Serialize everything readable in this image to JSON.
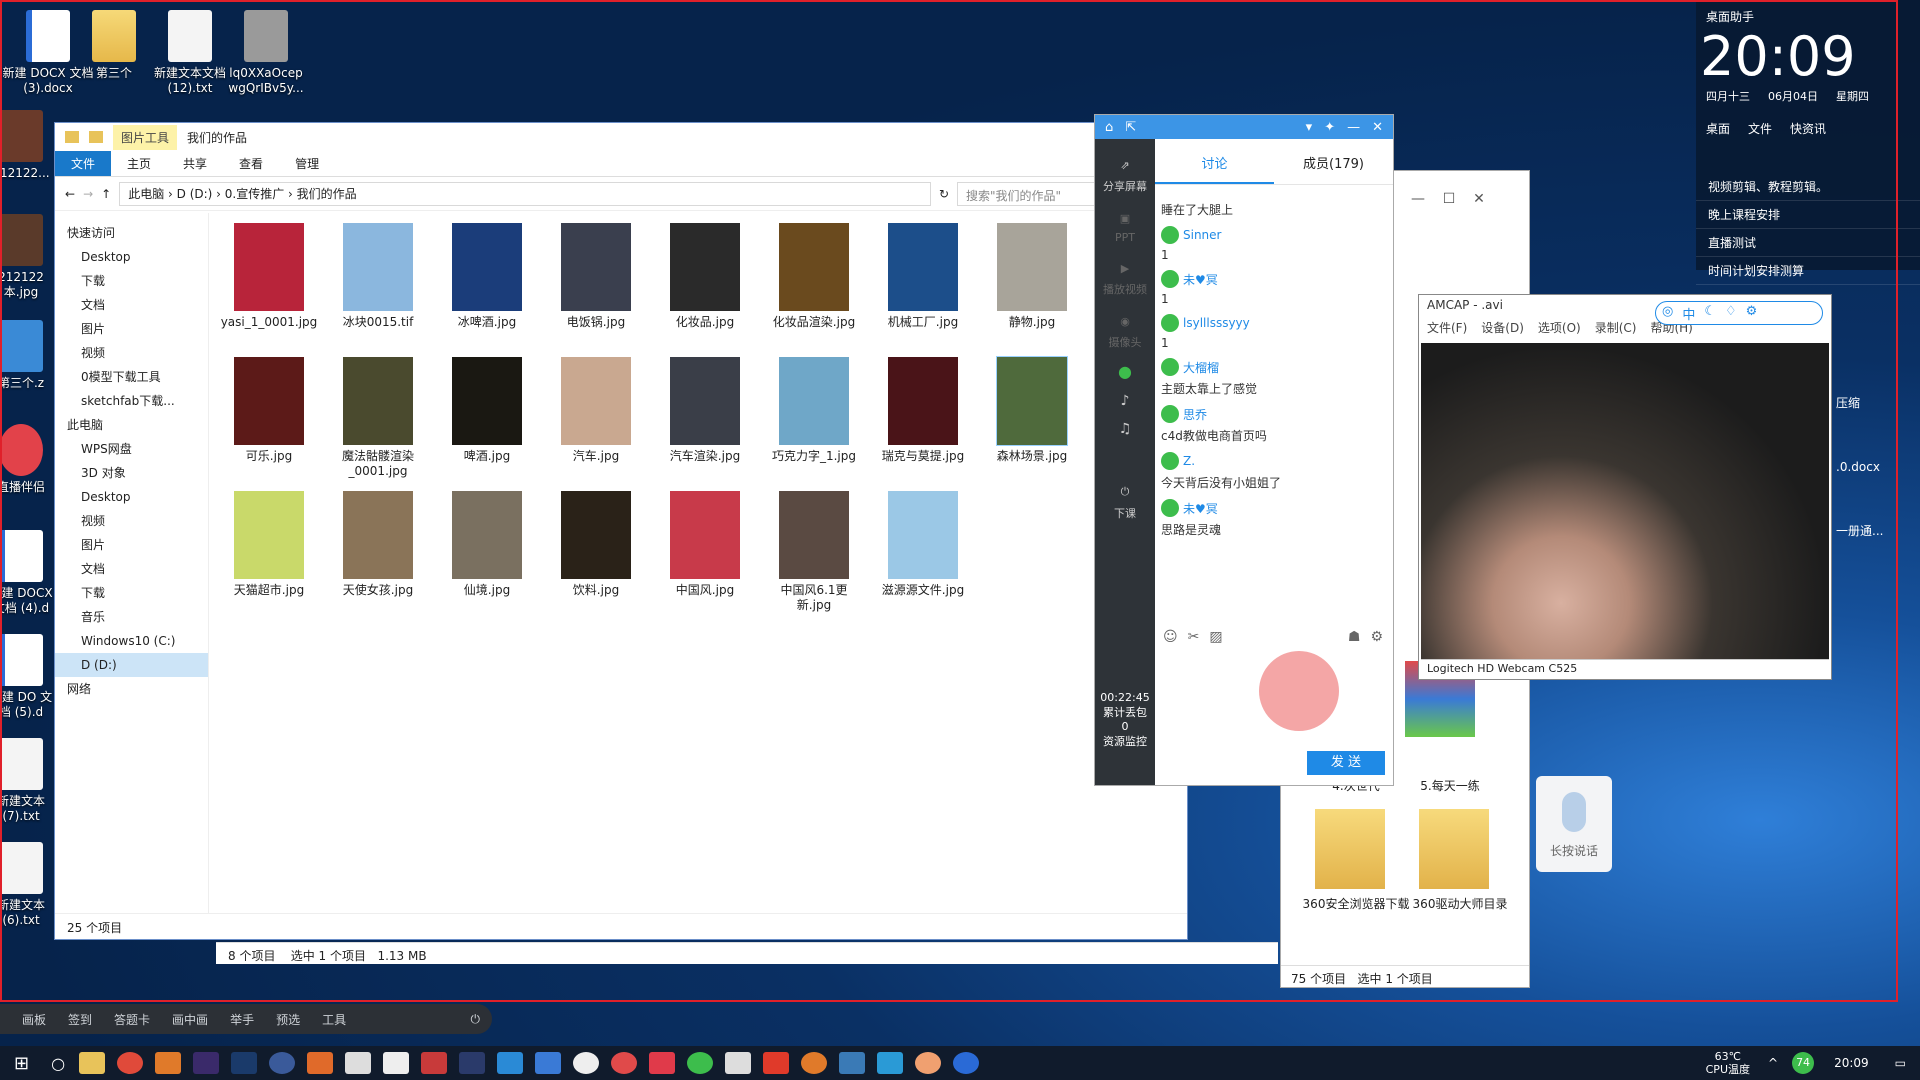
{
  "desktop": {
    "icons": [
      {
        "label": "新建 DOCX 文档 (3).docx",
        "type": "docx"
      },
      {
        "label": "第三个",
        "type": "folder"
      },
      {
        "label": "新建文本文档 (12).txt",
        "type": "txt"
      },
      {
        "label": "lq0XXaOcep wgQrIBv5y...",
        "type": "img"
      },
      {
        "label": "212122...",
        "type": "img"
      },
      {
        "label": "212122 本.jpg",
        "type": "img"
      },
      {
        "label": "第三个.z",
        "type": "zip"
      },
      {
        "label": "直播伴侣",
        "type": "app"
      },
      {
        "label": "新建 DOCX 文档 (4).d",
        "type": "docx"
      },
      {
        "label": "新建 DO 文档 (5).d",
        "type": "docx"
      },
      {
        "label": "新建文本 (7).txt",
        "type": "txt"
      },
      {
        "label": "新建文本 (6).txt",
        "type": "txt"
      }
    ],
    "right_icons": [
      {
        "label": "4.次世代"
      },
      {
        "label": "5.每天一练"
      },
      {
        "label": "360安全浏览器下载"
      },
      {
        "label": "360驱动大师目录"
      }
    ]
  },
  "explorer": {
    "quick": {
      "tool_label": "图片工具",
      "title": "我们的作品"
    },
    "ribbon": [
      "文件",
      "主页",
      "共享",
      "查看",
      "管理"
    ],
    "breadcrumb": [
      "此电脑",
      "D (D:)",
      "0.宣传推广",
      "我们的作品"
    ],
    "search_placeholder": "搜索\"我们的作品\"",
    "nav": [
      {
        "label": "快速访问",
        "level": "h"
      },
      {
        "label": "Desktop"
      },
      {
        "label": "下载"
      },
      {
        "label": "文档"
      },
      {
        "label": "图片"
      },
      {
        "label": "视频"
      },
      {
        "label": "0模型下载工具"
      },
      {
        "label": "sketchfab下载..."
      },
      {
        "label": "此电脑",
        "level": "h"
      },
      {
        "label": "WPS网盘"
      },
      {
        "label": "3D 对象"
      },
      {
        "label": "Desktop"
      },
      {
        "label": "视频"
      },
      {
        "label": "图片"
      },
      {
        "label": "文档"
      },
      {
        "label": "下载"
      },
      {
        "label": "音乐"
      },
      {
        "label": "Windows10 (C:)"
      },
      {
        "label": "D (D:)",
        "selected": true
      },
      {
        "label": "网络",
        "level": "h"
      }
    ],
    "files": [
      {
        "name": "yasi_1_0001.jpg",
        "color": "#b8243a"
      },
      {
        "name": "冰块0015.tif",
        "color": "#8bb7de"
      },
      {
        "name": "冰啤酒.jpg",
        "color": "#1b3d7a"
      },
      {
        "name": "电饭锅.jpg",
        "color": "#3a3f4e"
      },
      {
        "name": "化妆品.jpg",
        "color": "#2a2a2a"
      },
      {
        "name": "化妆品渲染.jpg",
        "color": "#6a4a1e"
      },
      {
        "name": "机械工厂.jpg",
        "color": "#1c4e8a"
      },
      {
        "name": "静物.jpg",
        "color": "#a8a49a"
      },
      {
        "name": "可乐.jpg",
        "color": "#5c1a18"
      },
      {
        "name": "魔法骷髅渲染_0001.jpg",
        "color": "#4a4a2e"
      },
      {
        "name": "啤酒.jpg",
        "color": "#1a1812"
      },
      {
        "name": "汽车.jpg",
        "color": "#c9a890"
      },
      {
        "name": "汽车渲染.jpg",
        "color": "#3a3e48"
      },
      {
        "name": "巧克力字_1.jpg",
        "color": "#6fa7c8"
      },
      {
        "name": "瑞克与莫提.jpg",
        "color": "#4a1418"
      },
      {
        "name": "森林场景.jpg",
        "color": "#4f6a3c",
        "selected": true
      },
      {
        "name": "天猫超市.jpg",
        "color": "#c9d96a"
      },
      {
        "name": "天使女孩.jpg",
        "color": "#8a7458"
      },
      {
        "name": "仙境.jpg",
        "color": "#7a7060"
      },
      {
        "name": "饮料.jpg",
        "color": "#2a2218"
      },
      {
        "name": "中国风.jpg",
        "color": "#c83a4a"
      },
      {
        "name": "中国风6.1更新.jpg",
        "color": "#5a4a42"
      },
      {
        "name": "滋源源文件.jpg",
        "color": "#9bc8e6"
      }
    ],
    "status": {
      "count": "25 个项目",
      "sub_count": "8 个项目",
      "selected": "选中 1 个项目",
      "size": "1.13 MB",
      "bottom_count": "75 个项目",
      "bottom_selected": "选中 1 个项目"
    }
  },
  "classroom": {
    "left_items": [
      "分享屏幕",
      "PPT",
      "播放视频",
      "摄像头",
      "下课"
    ],
    "timer": "00:22:45",
    "timer_sub": "累计丢包",
    "loss": "0",
    "monitor": "资源监控",
    "tabs": [
      "讨论",
      "成员(179)"
    ],
    "messages": [
      {
        "user": "",
        "text": "睡在了大腿上"
      },
      {
        "user": "Sinner",
        "text": "1"
      },
      {
        "user": "未♥冥",
        "text": "1"
      },
      {
        "user": "lsylllsssyyy",
        "text": "1"
      },
      {
        "user": "大榴榴",
        "text": "主题太靠上了感觉"
      },
      {
        "user": "思乔",
        "text": "c4d教做电商首页吗"
      },
      {
        "user": "Z.",
        "text": "今天背后没有小姐姐了"
      },
      {
        "user": "未♥冥",
        "text": "思路是灵魂"
      }
    ],
    "send_label": "发 送"
  },
  "amcap": {
    "title": "AMCAP - .avi",
    "menu": [
      "文件(F)",
      "设备(D)",
      "选项(O)",
      "录制(C)",
      "帮助(H)"
    ],
    "footer": "Logitech HD Webcam C525"
  },
  "assistant": {
    "title": "桌面助手",
    "time": "20:09",
    "weekday_cn": "四月十三",
    "date": "06月04日",
    "week": "星期四",
    "nav": [
      "桌面",
      "文件",
      "快资讯"
    ],
    "tasks": [
      "视频剪辑、教程剪辑。",
      "晚上课程安排",
      "直播测试",
      "时间计划安排测算"
    ]
  },
  "bg_window": {
    "side_labels": [
      "压缩",
      ".0.docx",
      "一册通..."
    ]
  },
  "voice": {
    "label": "长按说话"
  },
  "toolbar": [
    "画板",
    "签到",
    "答题卡",
    "画中画",
    "举手",
    "预选",
    "工具"
  ],
  "taskbar": {
    "temp": "63℃",
    "temp_label": "CPU温度",
    "badge": "74",
    "time": "20:09"
  }
}
